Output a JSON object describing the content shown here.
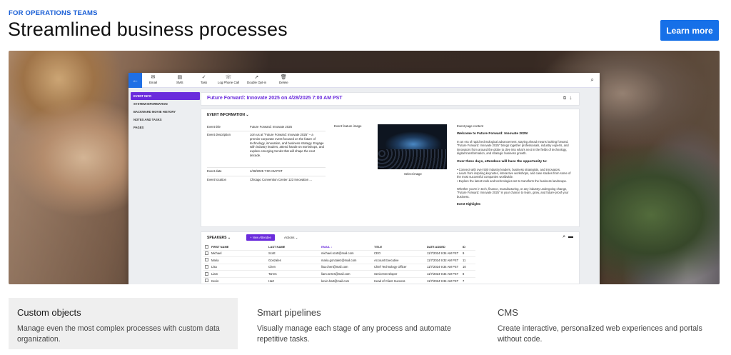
{
  "header": {
    "eyebrow": "FOR OPERATIONS TEAMS",
    "title": "Streamlined business processes",
    "cta_label": "Learn more"
  },
  "app": {
    "toolbar": {
      "back_icon": "arrow-left-icon",
      "items": [
        {
          "label": "Email",
          "icon": "email-icon",
          "glyph": "✉"
        },
        {
          "label": "SMS",
          "icon": "sms-icon",
          "glyph": "▤"
        },
        {
          "label": "Task",
          "icon": "task-icon",
          "glyph": "✓"
        },
        {
          "label": "Log Phone Call",
          "icon": "phone-icon",
          "glyph": "☏"
        },
        {
          "label": "Double Opt-in",
          "icon": "cursor-icon",
          "glyph": "➚"
        },
        {
          "label": "Delete",
          "icon": "trash-icon",
          "glyph": "🗑"
        }
      ]
    },
    "sidenav": [
      "EVENT INFO",
      "SYSTEM INFORMATION",
      "BACKWARD MOVIE HISTORY",
      "NOTES AND TASKS",
      "PAGES"
    ],
    "record_title": "Future Forward: Innovate 2025 on 4/28/2025 7:00 AM PST",
    "event": {
      "section_title": "EVENT INFORMATION",
      "title_label": "Event title",
      "title_value": "Future Forward: Innovate 2025",
      "desc_label": "Event description",
      "desc_value": "Join us at \"Future Forward: Innovate 2025\" – a premier corporate event focused on the future of technology, innovation, and business strategy. Engage with industry leaders, attend hands-on workshops, and explore emerging trends that will shape the next decade.",
      "date_label": "Event date",
      "date_value": "4/28/2025 7:00 AM PST",
      "location_label": "Event location",
      "location_value": "Chicago Convention Center 123 Innovation ...",
      "image_label": "Event feature image",
      "select_image": "Select image",
      "page_content_label": "Event page content",
      "pc_heading": "Welcome to Future Forward: Innovate 2025!",
      "pc_intro": "In an era of rapid technological advancement, staying ahead means looking forward. \"Future Forward: Innovate 2025\" brings together professionals, industry experts, and innovators from around the globe to dive into what's next in the fields of technology, digital transformation, and strategic business growth.",
      "pc_sub": "Over three days, attendees will have the opportunity to:",
      "pc_bullets": [
        "Connect with over 500 industry leaders, business strategists, and innovators.",
        "Learn from inspiring keynotes, interactive workshops, and case studies from some of the most successful companies worldwide.",
        "Explore the latest tools and technologies set to transform the business landscape."
      ],
      "pc_closing": "Whether you're in tech, finance, manufacturing, or any industry undergoing change, \"Future Forward: Innovate 2025\" is your chance to learn, grow, and future-proof your business.",
      "pc_highlights": "Event Highlights"
    },
    "speakers": {
      "title": "SPEAKERS",
      "new_button": "+ New Attendee",
      "actions": "Actions",
      "columns": [
        "FIRST NAME",
        "LAST NAME",
        "EMAIL ↓",
        "TITLE",
        "DATE ADDED",
        "ID"
      ],
      "rows": [
        [
          "Michael",
          "Scott",
          "michael.scott@mail.com",
          "CEO",
          "11/7/2024 9:34 AM PST",
          "9"
        ],
        [
          "Maria",
          "Gonzales",
          "maria.gonzalez@mail.com",
          "Account Executive",
          "11/7/2024 9:32 AM PST",
          "11"
        ],
        [
          "Lisa",
          "Chen",
          "lisa.chen@mail.com",
          "Chief Technology Officer",
          "11/7/2024 9:34 AM PST",
          "10"
        ],
        [
          "Liam",
          "Torres",
          "liam.torres@mail.com",
          "Senior Developer",
          "11/7/2024 9:34 AM PST",
          "8"
        ],
        [
          "Kevin",
          "Hart",
          "kevin.hart@mail.com",
          "Head of Client Success",
          "11/7/2024 9:34 AM PST",
          "7"
        ],
        [
          "Karen",
          "Li",
          "karen.li@mail.com",
          "Head of Marketing",
          "11/7/2024 9:34 AM PST",
          "4"
        ],
        [
          "John",
          "Evans",
          "john.evans@mail.com",
          "Director of Operations",
          "11/7/2024 9:34 AM PST",
          "6"
        ]
      ]
    }
  },
  "features": [
    {
      "title": "Custom objects",
      "desc": "Manage even the most complex processes with custom data organization."
    },
    {
      "title": "Smart pipelines",
      "desc": "Visually manage each stage of any process and automate repetitive tasks."
    },
    {
      "title": "CMS",
      "desc": "Create interactive, personalized web experiences and portals without code."
    }
  ]
}
